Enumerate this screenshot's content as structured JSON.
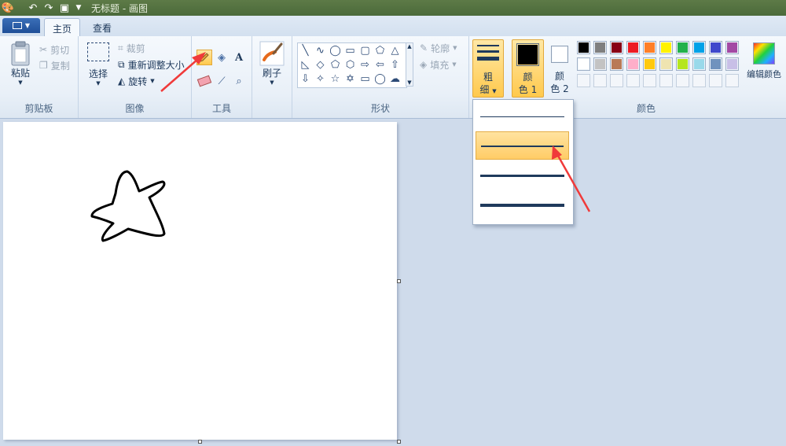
{
  "titlebar": {
    "title": "无标题 - 画图"
  },
  "tabs": [
    {
      "label": "主页"
    },
    {
      "label": "查看"
    }
  ],
  "clipboard": {
    "paste": "粘贴",
    "cut": "剪切",
    "copy": "复制",
    "label": "剪贴板"
  },
  "image": {
    "select": "选择",
    "crop": "裁剪",
    "resize": "重新调整大小",
    "rotate": "旋转",
    "label": "图像"
  },
  "tools": {
    "label": "工具"
  },
  "brushes": {
    "label": "刷子"
  },
  "shapes": {
    "outline": "轮廓",
    "fill": "填充",
    "label": "形状"
  },
  "size": {
    "label_top": "粗",
    "label_bottom": "细"
  },
  "color1": {
    "label_top": "颜",
    "label_bottom": "色 1",
    "value": "#000000"
  },
  "color2": {
    "label_top": "颜",
    "label_bottom": "色 2",
    "value": "#ffffff"
  },
  "colors": {
    "label": "颜色",
    "edit": "编辑颜色",
    "row1": [
      "#000000",
      "#7f7f7f",
      "#880015",
      "#ed1c24",
      "#ff7f27",
      "#fff200",
      "#22b14c",
      "#00a2e8",
      "#3f48cc",
      "#a349a4"
    ],
    "row2": [
      "#ffffff",
      "#c3c3c3",
      "#b97a57",
      "#ffaec9",
      "#ffc90e",
      "#efe4b0",
      "#b5e61d",
      "#99d9ea",
      "#7092be",
      "#c8bfe7"
    ]
  },
  "size_options": [
    {
      "thickness": 1
    },
    {
      "thickness": 2
    },
    {
      "thickness": 3
    },
    {
      "thickness": 4
    }
  ]
}
